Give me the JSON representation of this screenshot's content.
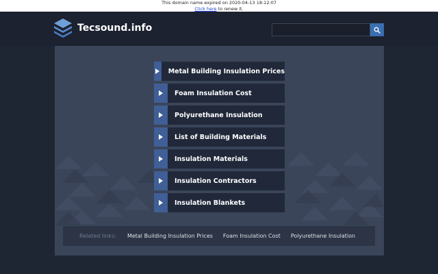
{
  "expiry_notice": {
    "line1": "This domain name expired on 2020-04-13 18:12:07",
    "renew_link": "Click here",
    "renew_suffix": " to renew it."
  },
  "header": {
    "logo_icon": "stack-icon",
    "site_name": "Tecsound.info",
    "search": {
      "placeholder": "",
      "value": ""
    },
    "search_icon": "search-icon"
  },
  "main": {
    "links": [
      {
        "label": "Metal Building Insulation Prices"
      },
      {
        "label": "Foam Insulation Cost"
      },
      {
        "label": "Polyurethane Insulation"
      },
      {
        "label": "List of Building Materials"
      },
      {
        "label": "Insulation Materials"
      },
      {
        "label": "Insulation Contractors"
      },
      {
        "label": "Insulation Blankets"
      }
    ],
    "link_icon": "play-arrow-icon"
  },
  "related": {
    "title": "Related links:",
    "links": [
      "Metal Building Insulation Prices",
      "Foam Insulation Cost",
      "Polyurethane Insulation"
    ]
  },
  "colors": {
    "page_background": "#1f2633",
    "panel_background": "#3b4559",
    "link_background": "#20283a",
    "arrow_background": "#3f5f96",
    "search_button": "#3a6fb0"
  }
}
